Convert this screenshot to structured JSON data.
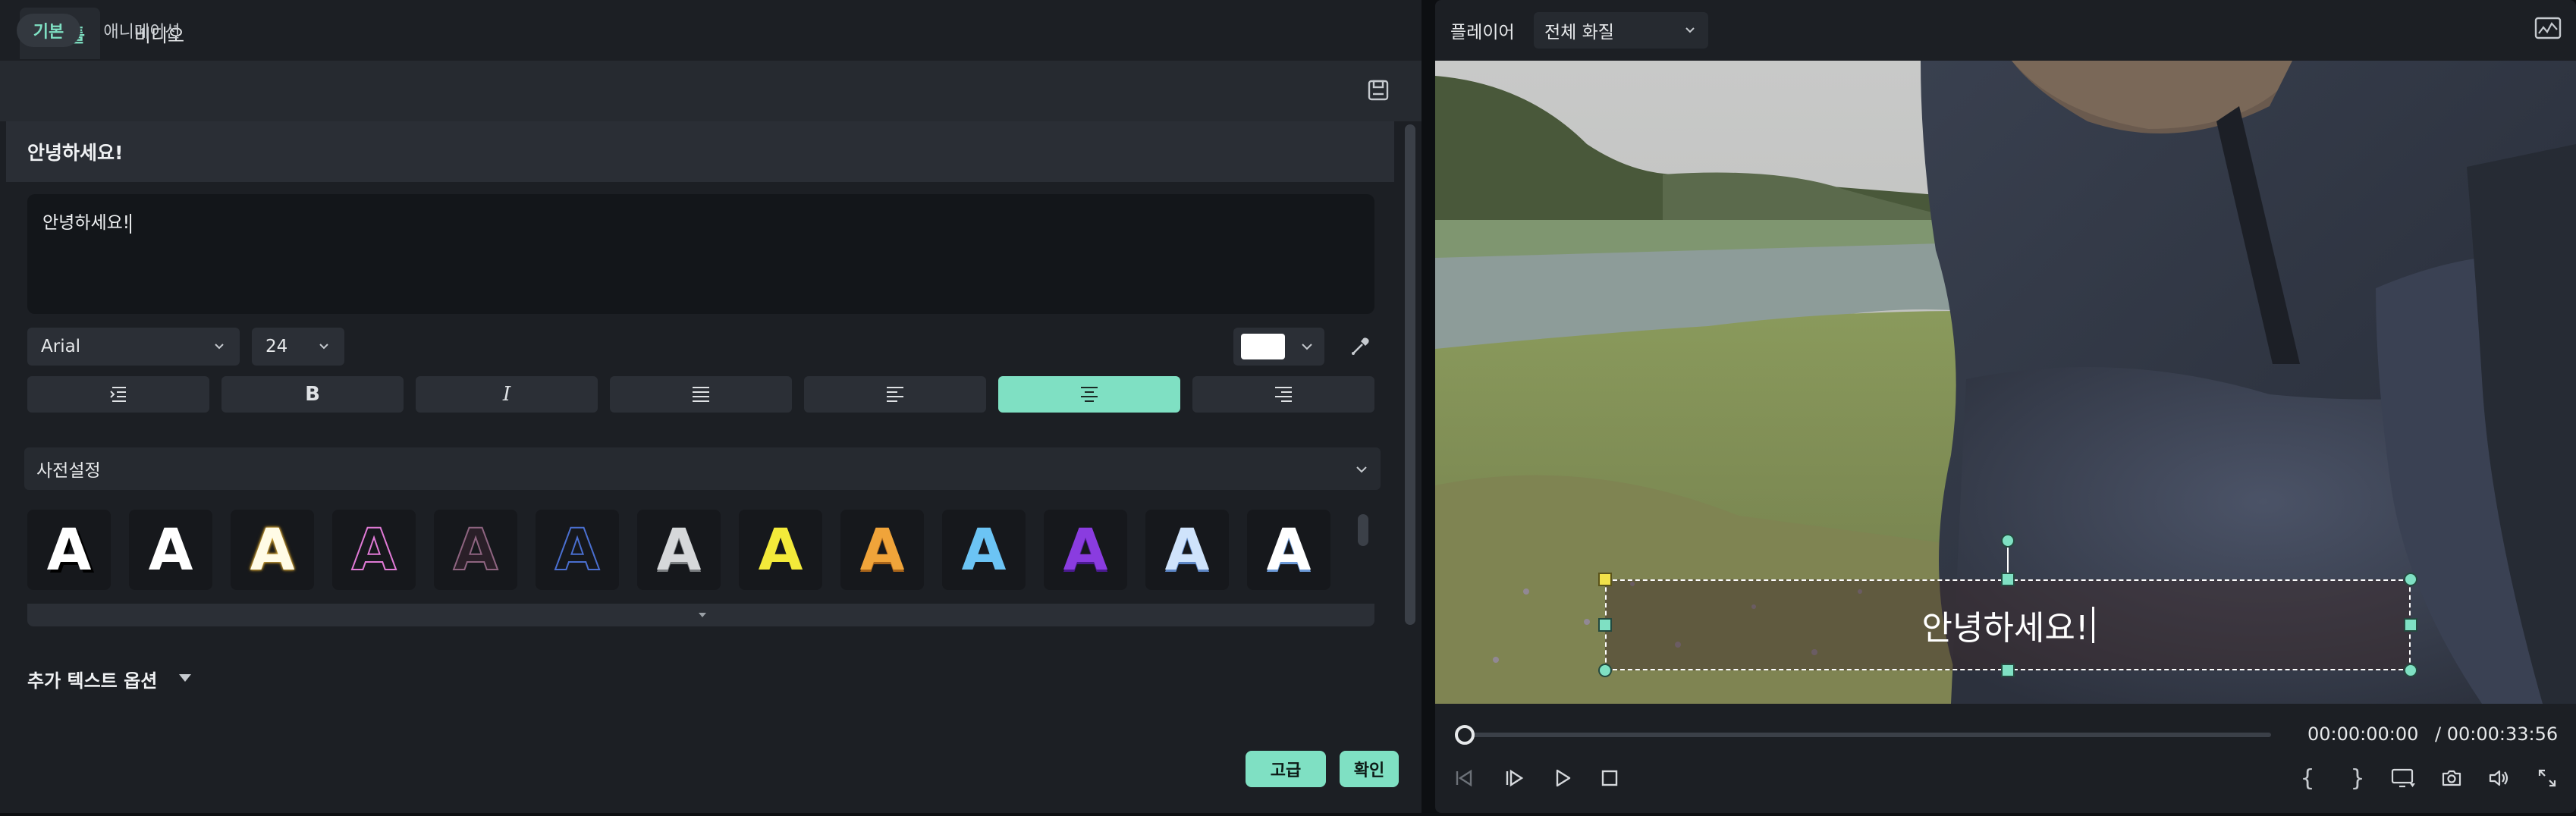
{
  "tabs": {
    "title": "타이틀",
    "video": "비디오"
  },
  "subtabs": {
    "basic": "기본",
    "animation": "애니메이션"
  },
  "text_header": "안녕하세요!",
  "text_input_value": "안녕하세요!",
  "font": {
    "family": "Arial",
    "size": "24"
  },
  "color": {
    "text_color": "#ffffff",
    "accent": "#7fe0c3"
  },
  "format_buttons": [
    {
      "icon": "text-spacing-icon",
      "active": false
    },
    {
      "icon": "bold-icon",
      "label": "B",
      "active": false
    },
    {
      "icon": "italic-icon",
      "label": "I",
      "active": false
    },
    {
      "icon": "align-justify-icon",
      "active": false
    },
    {
      "icon": "align-left-icon",
      "active": false
    },
    {
      "icon": "align-center-icon",
      "active": true
    },
    {
      "icon": "align-right-icon",
      "active": false
    }
  ],
  "presets": {
    "label": "사전설정",
    "glyph": "A",
    "tiles": [
      {
        "style": "white-shadow"
      },
      {
        "style": "white-plain"
      },
      {
        "style": "gold-outline"
      },
      {
        "style": "pink-outline"
      },
      {
        "style": "mauve-outline"
      },
      {
        "style": "blue-outline"
      },
      {
        "style": "silver-gradient"
      },
      {
        "style": "yellow"
      },
      {
        "style": "orange-gradient"
      },
      {
        "style": "sky-blue"
      },
      {
        "style": "purple-gradient"
      },
      {
        "style": "light-blue-gradient"
      },
      {
        "style": "white-blue-gradient"
      }
    ]
  },
  "extra_options_label": "추가 텍스트 옵션",
  "buttons": {
    "advanced": "고급",
    "confirm": "확인"
  },
  "player": {
    "label": "플레이어",
    "quality": "전체 화질",
    "overlay_title": "안녕하세요!",
    "time_current": "00:00:00:00",
    "time_total": "/ 00:00:33:56",
    "progress": 0
  }
}
